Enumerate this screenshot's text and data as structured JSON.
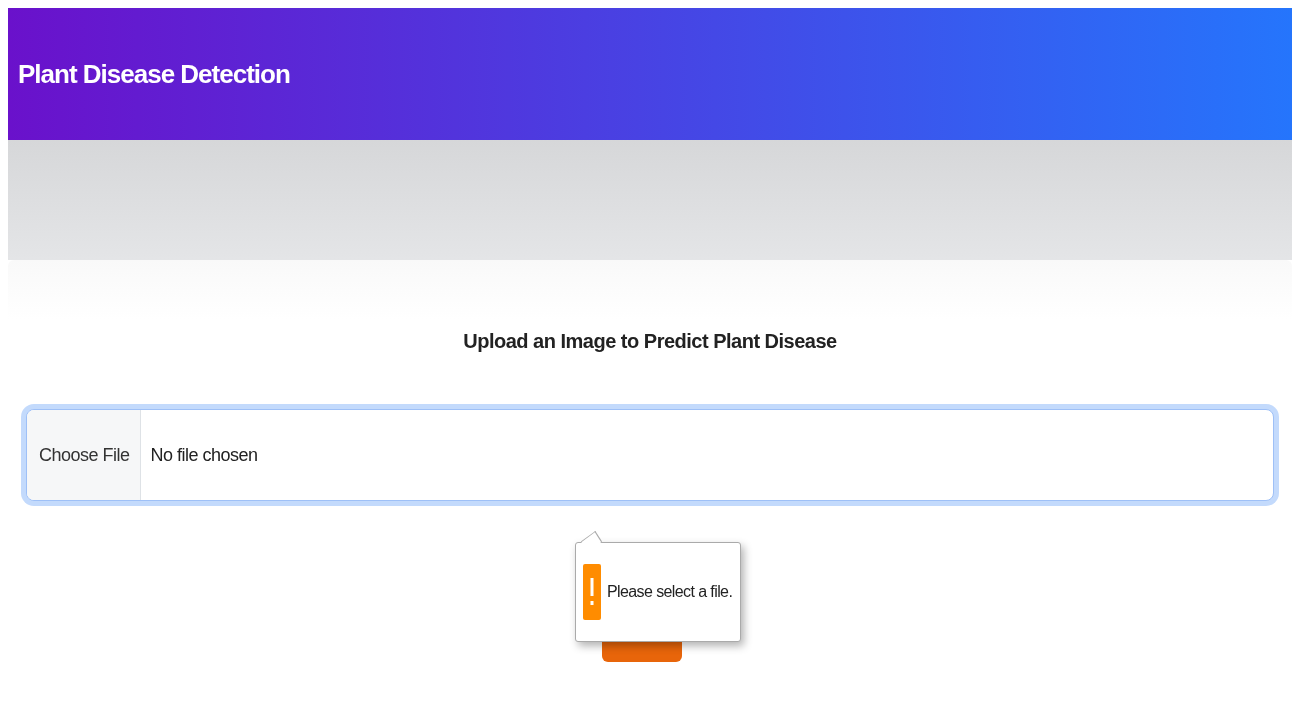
{
  "header": {
    "title": "Plant Disease Detection"
  },
  "upload": {
    "heading": "Upload an Image to Predict Plant Disease",
    "file_input": {
      "button_label": "Choose File",
      "status": "No file chosen",
      "focused": true
    },
    "validation": {
      "message": "Please select a file."
    }
  }
}
